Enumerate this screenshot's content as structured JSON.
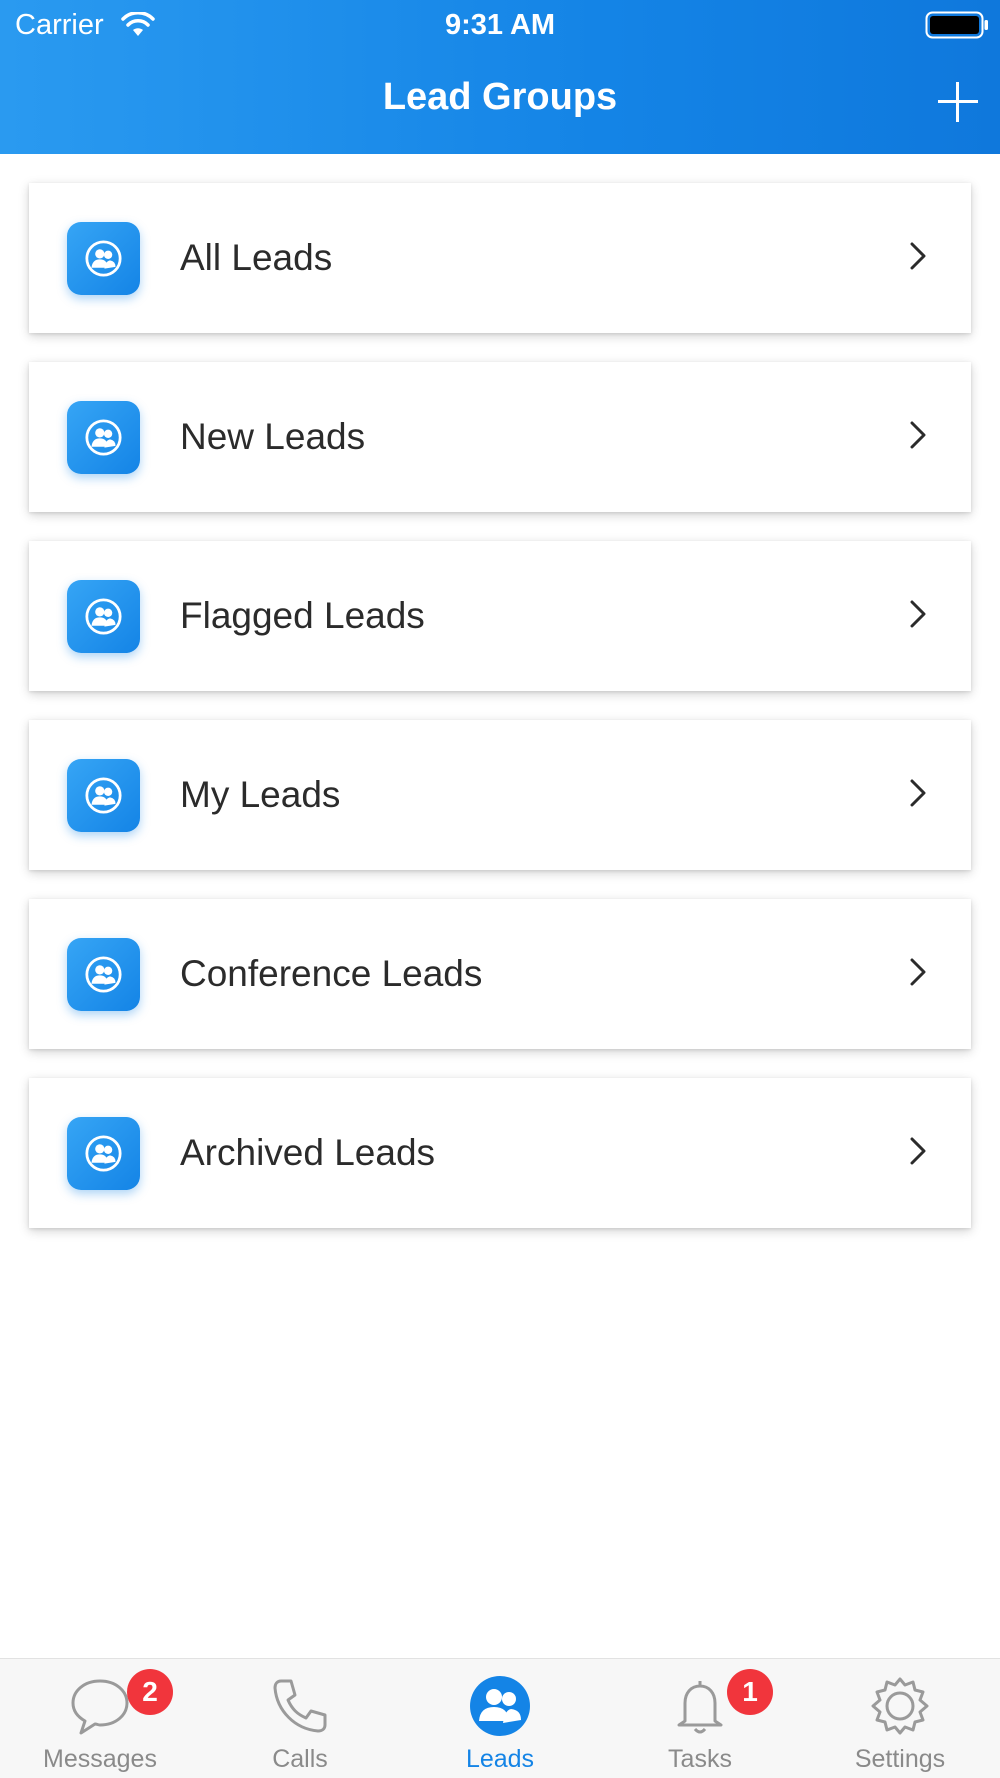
{
  "status_bar": {
    "carrier": "Carrier",
    "time": "9:31 AM"
  },
  "nav": {
    "title": "Lead Groups",
    "add_icon": "plus-icon"
  },
  "groups": [
    {
      "label": "All Leads"
    },
    {
      "label": "New Leads"
    },
    {
      "label": "Flagged Leads"
    },
    {
      "label": "My Leads"
    },
    {
      "label": "Conference Leads"
    },
    {
      "label": "Archived Leads"
    }
  ],
  "tabbar": {
    "tabs": [
      {
        "label": "Messages",
        "icon": "chat-bubble-icon",
        "badge": "2"
      },
      {
        "label": "Calls",
        "icon": "phone-icon"
      },
      {
        "label": "Leads",
        "icon": "leads-people-icon",
        "active": true
      },
      {
        "label": "Tasks",
        "icon": "bell-icon",
        "badge": "1"
      },
      {
        "label": "Settings",
        "icon": "gear-icon"
      }
    ]
  },
  "colors": {
    "accent": "#1484e6",
    "badge": "#f1353c",
    "inactive_tab": "#8a8a8a"
  }
}
